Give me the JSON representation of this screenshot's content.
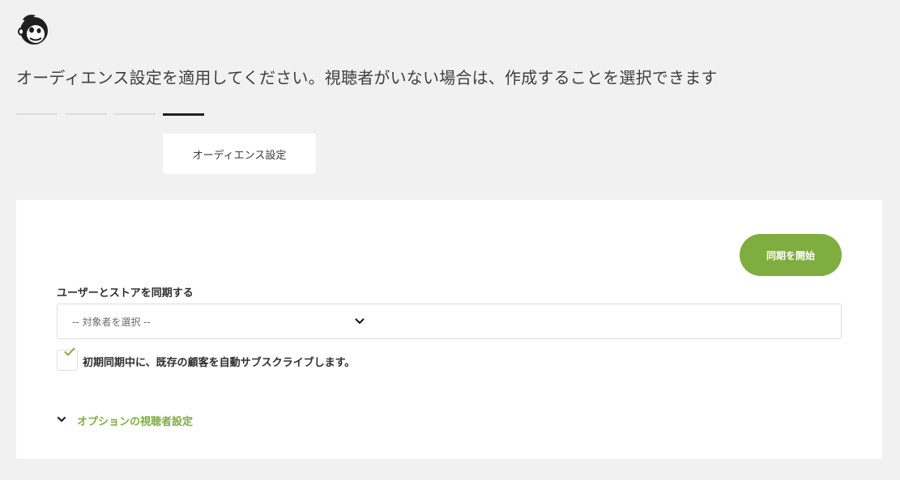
{
  "brand": {
    "logo_icon": "mailchimp-freddie-icon"
  },
  "page": {
    "headline": "オーディエンス設定を適用してください。視聴者がいない場合は、作成することを選択できます"
  },
  "steps": {
    "count": 4,
    "active_index": 3,
    "active_tooltip": "オーディエンス設定"
  },
  "form": {
    "sync_button_label": "同期を開始",
    "sync_field_label": "ユーザーとストアを同期する",
    "audience_select_value": "-- 対象者を選択 --",
    "auto_subscribe_label": "初期同期中に、既存の顧客を自動サブスクライブします。",
    "auto_subscribe_checked": true,
    "optional_settings_label": "オプションの視聴者設定"
  },
  "colors": {
    "accent_green": "#7fad40",
    "background": "#f1f1f1",
    "panel": "#ffffff",
    "active_step": "#1f1f1f"
  }
}
